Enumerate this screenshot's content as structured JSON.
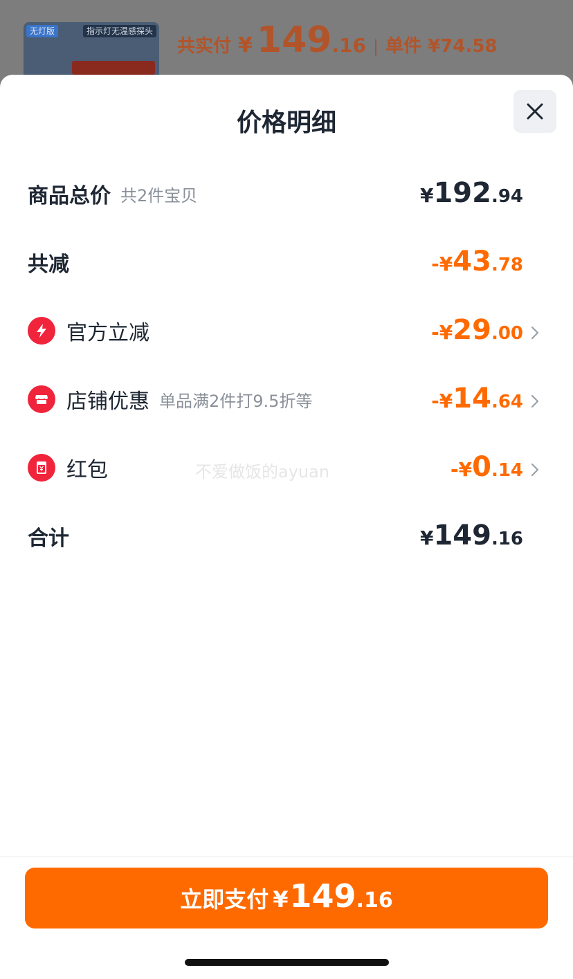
{
  "background": {
    "thumb_tag_left": "无灯版",
    "thumb_tag_right": "指示灯无温感探头",
    "total_label": "共实付",
    "total_yen": "¥",
    "total_int": "149",
    "total_dec": ".16",
    "separator": "|",
    "unit_label": "单件 ¥74.58"
  },
  "sheet": {
    "title": "价格明细"
  },
  "rows": {
    "total": {
      "label": "商品总价",
      "sub": "共2件宝贝",
      "yen": "¥",
      "int": "192",
      "dec": ".94"
    },
    "reduce": {
      "label": "共减",
      "yen": "-¥",
      "int": "43",
      "dec": ".78"
    },
    "official": {
      "label": "官方立减",
      "yen": "-¥",
      "int": "29",
      "dec": ".00",
      "icon": "lightning-icon"
    },
    "store": {
      "label": "店铺优惠",
      "sub": "单品满2件打9.5折等",
      "yen": "-¥",
      "int": "14",
      "dec": ".64",
      "icon": "store-icon"
    },
    "redpacket": {
      "label": "红包",
      "yen": "-¥",
      "int": "0",
      "dec": ".14",
      "icon": "red-packet-icon"
    },
    "sum": {
      "label": "合计",
      "yen": "¥",
      "int": "149",
      "dec": ".16"
    }
  },
  "watermark": "不爱做饭的ayuan",
  "pay": {
    "label": "立即支付",
    "yen": "¥",
    "int": "149",
    "dec": ".16"
  },
  "colors": {
    "accent": "#ff6a00",
    "icon_red": "#f0243b",
    "text_dark": "#1e2733",
    "text_muted": "#8a909a"
  }
}
